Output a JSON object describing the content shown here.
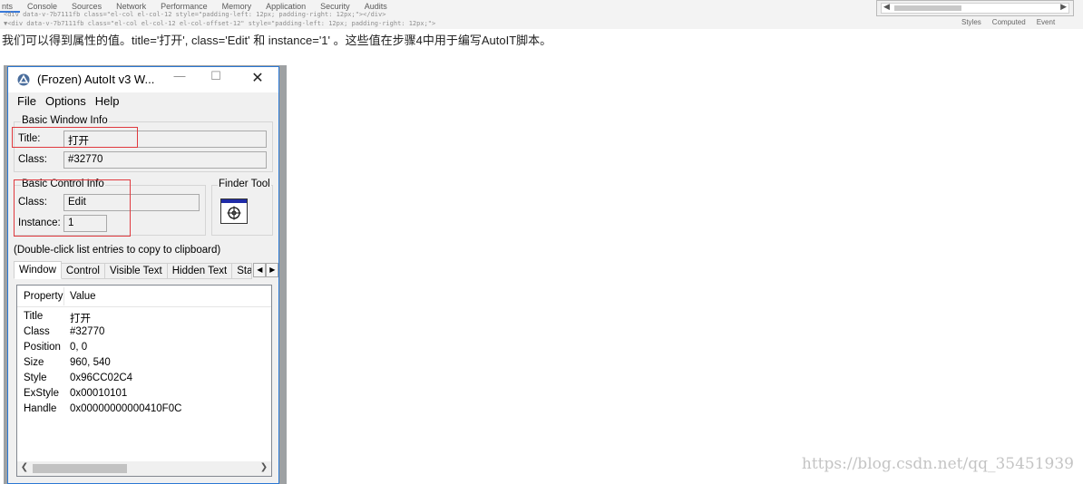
{
  "devtools": {
    "tabs": [
      "nts",
      "Console",
      "Sources",
      "Network",
      "Performance",
      "Memory",
      "Application",
      "Security",
      "Audits"
    ],
    "code_line_1": "<div data-v-7b7111fb class=\"el-col el-col-12 style=\"padding-left: 12px; padding-right: 12px;\"></div>",
    "code_line_2": "▼<div data-v-7b7111fb class=\"el-col el-col-12 el-col-offset-12\" style=\"padding-left: 12px; padding-right: 12px;\">",
    "sidebar_tabs": [
      "Styles",
      "Computed",
      "Event"
    ]
  },
  "paragraph": "我们可以得到属性的值。title='打开', class='Edit' 和 instance='1' 。这些值在步骤4中用于编写AutoIT脚本。",
  "window": {
    "title": "(Frozen) AutoIt v3 W...",
    "menu": [
      "File",
      "Options",
      "Help"
    ],
    "basic_window_info": {
      "group_label": "Basic Window Info",
      "title_label": "Title:",
      "title_value": "打开",
      "class_label": "Class:",
      "class_value": "#32770"
    },
    "basic_control_info": {
      "group_label": "Basic Control Info",
      "class_label": "Class:",
      "class_value": "Edit",
      "instance_label": "Instance:",
      "instance_value": "1"
    },
    "finder_tool": {
      "label": "Finder Tool"
    },
    "hint": "(Double-click list entries to copy to clipboard)",
    "tabs": [
      "Window",
      "Control",
      "Visible Text",
      "Hidden Text",
      "Stat"
    ],
    "active_tab": "Window",
    "list": {
      "headers": [
        "Property",
        "Value"
      ],
      "rows": [
        {
          "property": "Title",
          "value": "打开"
        },
        {
          "property": "Class",
          "value": "#32770"
        },
        {
          "property": "Position",
          "value": "0, 0"
        },
        {
          "property": "Size",
          "value": "960, 540"
        },
        {
          "property": "Style",
          "value": "0x96CC02C4"
        },
        {
          "property": "ExStyle",
          "value": "0x00010101"
        },
        {
          "property": "Handle",
          "value": "0x00000000000410F0C"
        }
      ]
    }
  },
  "watermark": "https://blog.csdn.net/qq_35451939",
  "colors": {
    "accent_border": "#2b78d4",
    "highlight_box": "#e0393e",
    "devtools_tab": "#3879d9"
  }
}
